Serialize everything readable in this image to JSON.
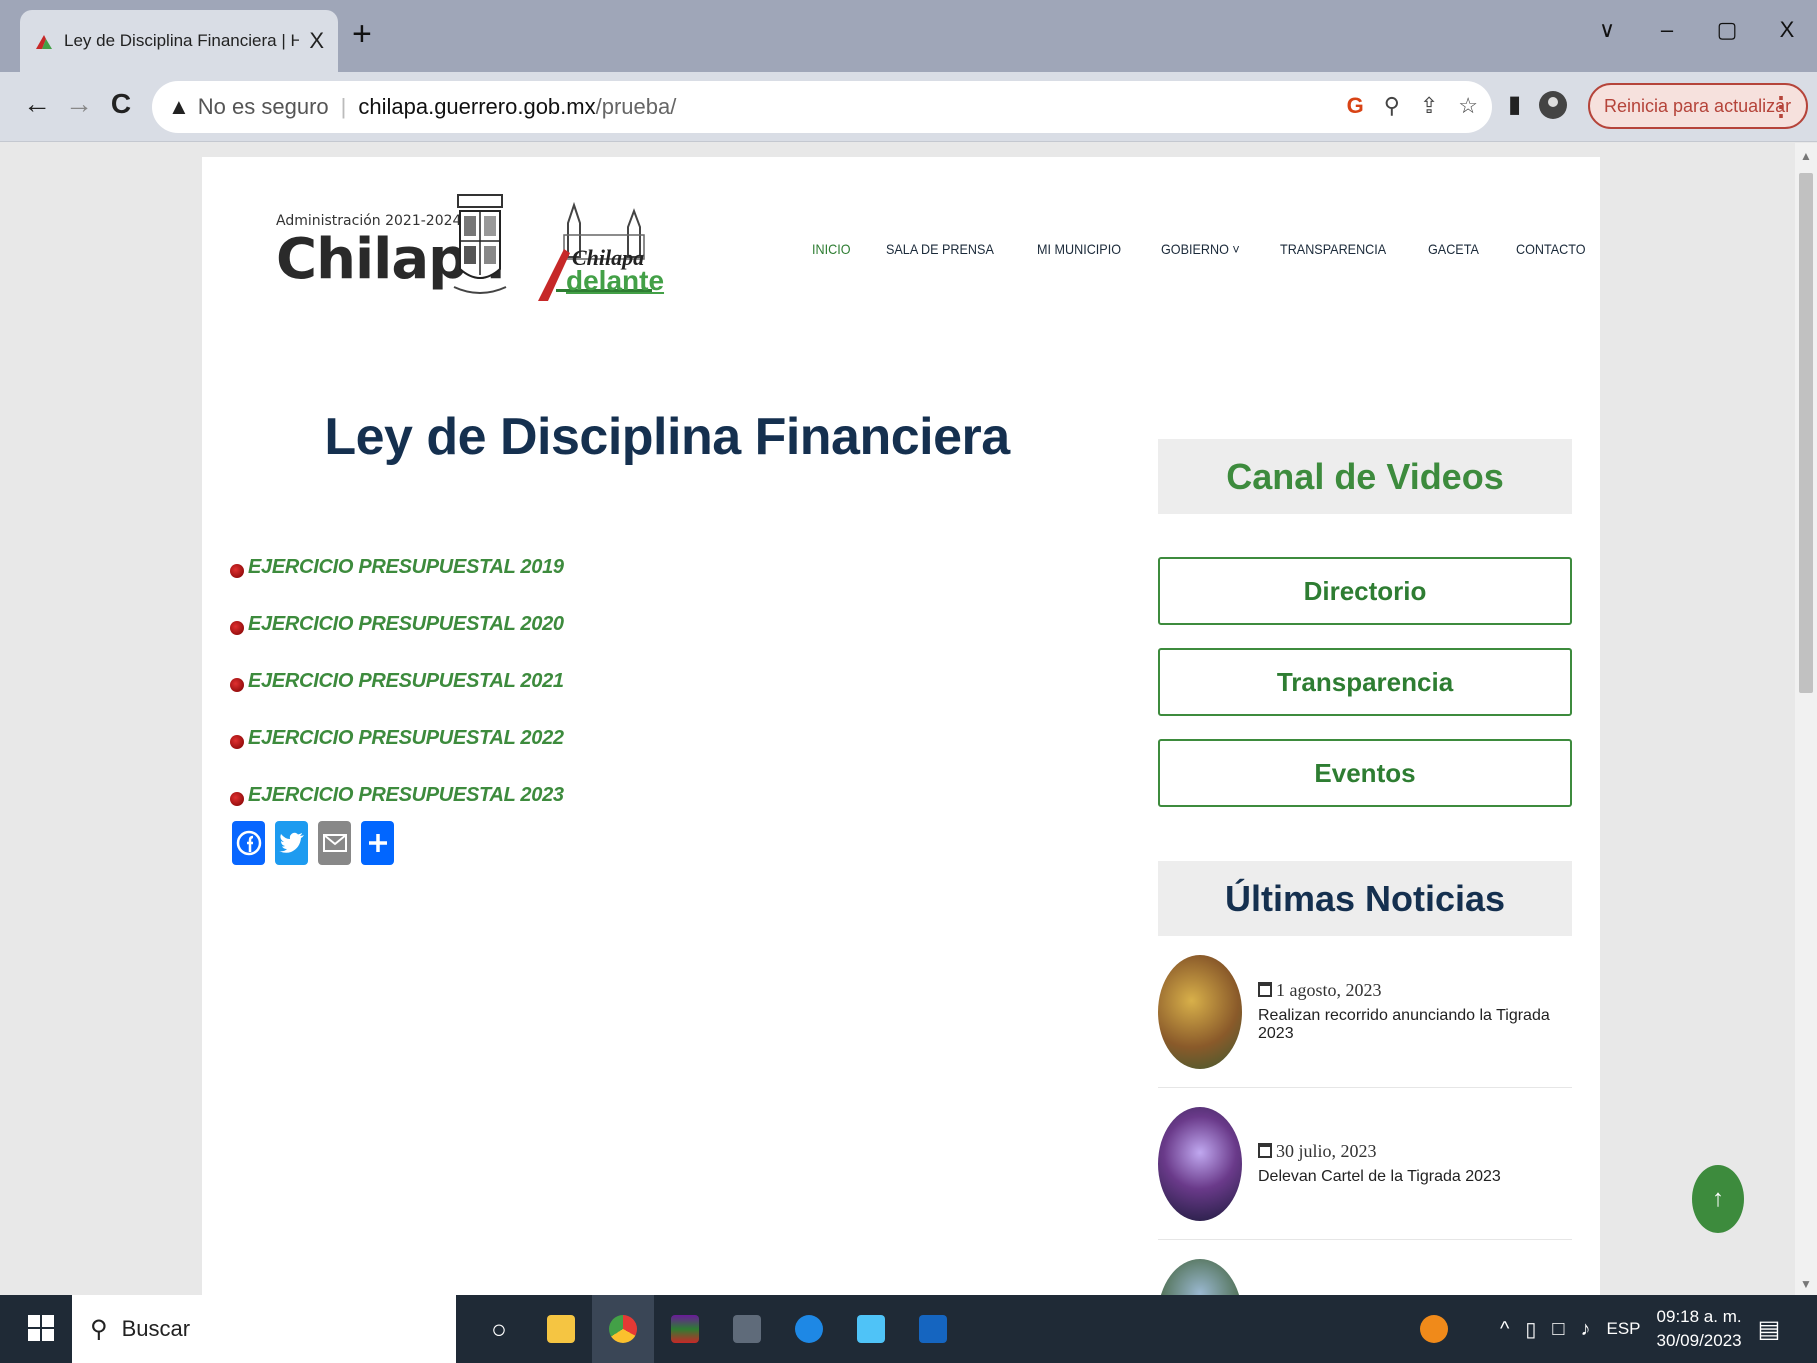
{
  "browser": {
    "tab_title": "Ley de Disciplina Financiera | H. A",
    "tab_close": "X",
    "new_tab": "+",
    "win_min": "–",
    "win_max": "▢",
    "win_close": "X",
    "win_dropdown": "∨",
    "back": "←",
    "forward": "→",
    "reload": "C",
    "security_label": "No es seguro",
    "url_host": "chilapa.guerrero.gob.mx",
    "url_path": "/prueba/",
    "update_button": "Reinicia para actualizar",
    "menu_dots": "⋮"
  },
  "site": {
    "logo_admin_text": "Administración 2021-2024",
    "logo_name": "Chilapa",
    "logo_slogan_top": "Chilapa",
    "logo_slogan_bottom": "delante",
    "nav": [
      "INICIO",
      "SALA DE PRENSA",
      "MI MUNICIPIO",
      "GOBIERNO",
      "TRANSPARENCIA",
      "GACETA",
      "CONTACTO"
    ],
    "nav_dropdown_marker": "˅"
  },
  "main": {
    "title": "Ley de Disciplina Financiera",
    "exercises": [
      "EJERCICIO PRESUPUESTAL 2019",
      "EJERCICIO PRESUPUESTAL 2020",
      "EJERCICIO PRESUPUESTAL 2021",
      "EJERCICIO PRESUPUESTAL 2022",
      "EJERCICIO PRESUPUESTAL 2023"
    ]
  },
  "sidebar": {
    "canal_heading": "Canal de Videos",
    "buttons": [
      "Directorio",
      "Transparencia",
      "Eventos"
    ],
    "news_heading": "Últimas Noticias",
    "news": [
      {
        "date": "1 agosto, 2023",
        "title": "Realizan recorrido anunciando la Tigrada 2023"
      },
      {
        "date": "30 julio, 2023",
        "title": "Delevan Cartel de la Tigrada 2023"
      }
    ]
  },
  "taskbar": {
    "search_placeholder": "Buscar",
    "language": "ESP",
    "time": "09:18 a. m.",
    "date": "30/09/2023"
  },
  "colors": {
    "accent_green": "#3d8b3d",
    "title_navy": "#15304f",
    "update_red": "#b5443a"
  }
}
